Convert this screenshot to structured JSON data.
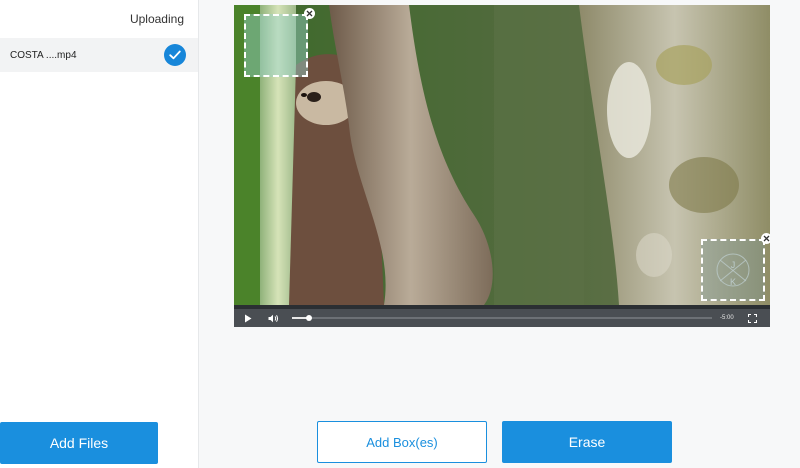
{
  "sidebar": {
    "status": "Uploading",
    "files": [
      {
        "name": "COSTA ....mp4",
        "state": "check-icon"
      }
    ],
    "add_files_label": "Add Files"
  },
  "player": {
    "time_remaining": "-5:00",
    "progress": 0.04,
    "icons": {
      "play": "play-icon",
      "volume": "volume-icon",
      "fullscreen": "fullscreen-icon",
      "box_close": "close-icon"
    },
    "selection_boxes_count": 2
  },
  "actions": {
    "add_box_label": "Add Box(es)",
    "erase_label": "Erase"
  },
  "colors": {
    "accent": "#1a8fde",
    "check": "#1786d9",
    "controls_bg": "#4a4e53"
  }
}
